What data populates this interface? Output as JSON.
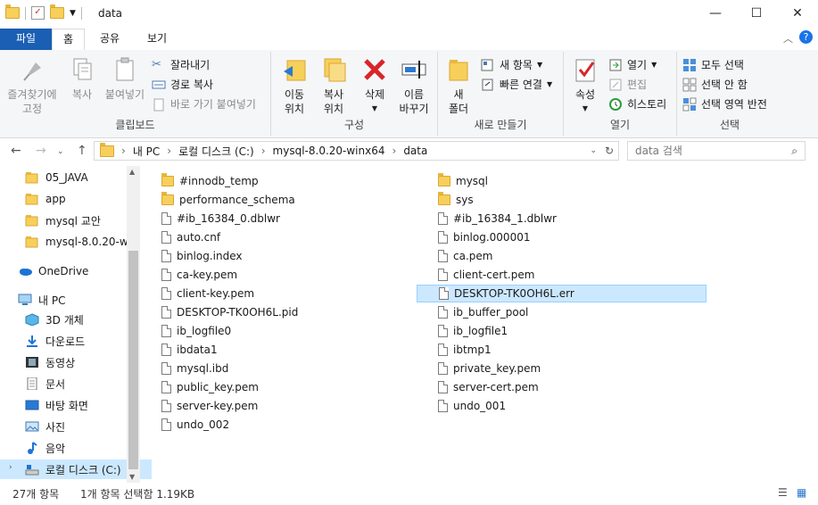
{
  "window": {
    "title": "data"
  },
  "ribbon_tabs": {
    "file": "파일",
    "home": "홈",
    "share": "공유",
    "view": "보기"
  },
  "clipboard": {
    "pin": "즐겨찾기에\n고정",
    "copy": "복사",
    "paste": "붙여넣기",
    "cut": "잘라내기",
    "copy_path": "경로 복사",
    "paste_shortcut": "바로 가기 붙여넣기",
    "label": "클립보드"
  },
  "organize": {
    "move": "이동\n위치",
    "copy_to": "복사\n위치",
    "delete": "삭제",
    "rename": "이름\n바꾸기",
    "label": "구성"
  },
  "new": {
    "new_folder": "새\n폴더",
    "new_item": "새 항목",
    "easy_access": "빠른 연결",
    "label": "새로 만들기"
  },
  "open": {
    "properties": "속성",
    "open": "열기",
    "edit": "편집",
    "history": "히스토리",
    "label": "열기"
  },
  "select": {
    "all": "모두 선택",
    "none": "선택 안 함",
    "invert": "선택 영역 반전",
    "label": "선택"
  },
  "address": {
    "crumbs": [
      "내 PC",
      "로컬 디스크 (C:)",
      "mysql-8.0.20-winx64",
      "data"
    ],
    "search_placeholder": "data 검색"
  },
  "nav_pane": [
    {
      "label": "05_JAVA",
      "icon": "folder-icon"
    },
    {
      "label": "app",
      "icon": "folder-icon"
    },
    {
      "label": "mysql 교안",
      "icon": "folder-icon"
    },
    {
      "label": "mysql-8.0.20-w",
      "icon": "folder-icon"
    },
    {
      "label": "OneDrive",
      "icon": "onedrive-icon"
    },
    {
      "label": "내 PC",
      "icon": "pc-icon"
    },
    {
      "label": "3D 개체",
      "icon": "3d-objects-icon"
    },
    {
      "label": "다운로드",
      "icon": "download-icon"
    },
    {
      "label": "동영상",
      "icon": "video-icon"
    },
    {
      "label": "문서",
      "icon": "document-icon"
    },
    {
      "label": "바탕 화면",
      "icon": "desktop-icon"
    },
    {
      "label": "사진",
      "icon": "pictures-icon"
    },
    {
      "label": "음악",
      "icon": "music-icon"
    },
    {
      "label": "로컬 디스크 (C:)",
      "icon": "drive-icon"
    }
  ],
  "files_left": [
    {
      "name": "#innodb_temp",
      "type": "folder"
    },
    {
      "name": "performance_schema",
      "type": "folder"
    },
    {
      "name": "#ib_16384_0.dblwr",
      "type": "file"
    },
    {
      "name": "auto.cnf",
      "type": "file"
    },
    {
      "name": "binlog.index",
      "type": "file"
    },
    {
      "name": "ca-key.pem",
      "type": "file"
    },
    {
      "name": "client-key.pem",
      "type": "file"
    },
    {
      "name": "DESKTOP-TK0OH6L.pid",
      "type": "file"
    },
    {
      "name": "ib_logfile0",
      "type": "file"
    },
    {
      "name": "ibdata1",
      "type": "file"
    },
    {
      "name": "mysql.ibd",
      "type": "file"
    },
    {
      "name": "public_key.pem",
      "type": "file"
    },
    {
      "name": "server-key.pem",
      "type": "file"
    },
    {
      "name": "undo_002",
      "type": "file"
    }
  ],
  "files_right": [
    {
      "name": "mysql",
      "type": "folder"
    },
    {
      "name": "sys",
      "type": "folder"
    },
    {
      "name": "#ib_16384_1.dblwr",
      "type": "file"
    },
    {
      "name": "binlog.000001",
      "type": "file"
    },
    {
      "name": "ca.pem",
      "type": "file"
    },
    {
      "name": "client-cert.pem",
      "type": "file"
    },
    {
      "name": "DESKTOP-TK0OH6L.err",
      "type": "file",
      "selected": true
    },
    {
      "name": "ib_buffer_pool",
      "type": "file"
    },
    {
      "name": "ib_logfile1",
      "type": "file"
    },
    {
      "name": "ibtmp1",
      "type": "file"
    },
    {
      "name": "private_key.pem",
      "type": "file"
    },
    {
      "name": "server-cert.pem",
      "type": "file"
    },
    {
      "name": "undo_001",
      "type": "file"
    }
  ],
  "status": {
    "count": "27개 항목",
    "selection": "1개 항목 선택함 1.19KB"
  }
}
